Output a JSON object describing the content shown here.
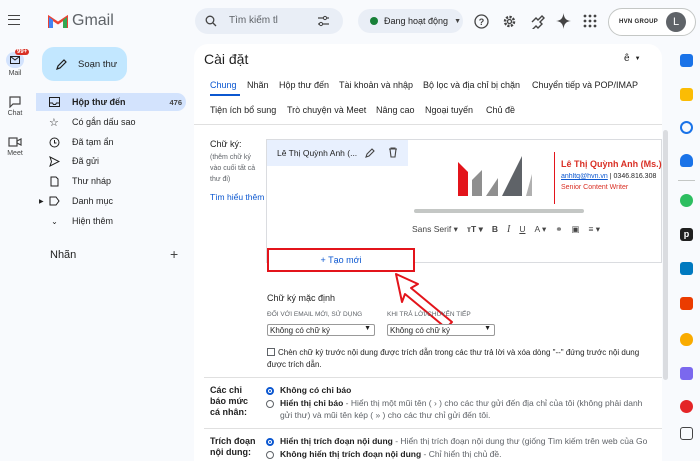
{
  "rail": {
    "mail_label": "Mail",
    "mail_badge": "99+",
    "chat_label": "Chat",
    "meet_label": "Meet"
  },
  "header": {
    "app_title": "Gmail",
    "search_placeholder": "Tìm kiếm tl",
    "status": "Đang hoạt động",
    "org": "HVN GROUP",
    "avatar_letter": "L"
  },
  "compose": {
    "label": "Soạn thư"
  },
  "nav": [
    {
      "label": "Hộp thư đến",
      "count": "476",
      "active": true
    },
    {
      "label": "Có gắn dấu sao",
      "count": ""
    },
    {
      "label": "Đã tạm ẩn",
      "count": ""
    },
    {
      "label": "Đã gửi",
      "count": ""
    },
    {
      "label": "Thư nháp",
      "count": ""
    },
    {
      "label": "Danh mục",
      "count": ""
    },
    {
      "label": "Hiện thêm",
      "count": ""
    }
  ],
  "labels_section": {
    "title": "Nhãn"
  },
  "settings": {
    "title": "Cài đặt",
    "lang_icon": "ê",
    "tabs_row1": [
      "Chung",
      "Nhãn",
      "Hộp thư đến",
      "Tài khoản và nhập",
      "Bộ lọc và địa chỉ bị chặn",
      "Chuyển tiếp và POP/IMAP"
    ],
    "tabs_row2": [
      "Tiện ích bổ sung",
      "Trò chuyện và Meet",
      "Nâng cao",
      "Ngoại tuyến",
      "Chủ đề"
    ]
  },
  "signature": {
    "label": "Chữ ký:",
    "help": "(thêm chữ ký vào cuối tất cả thư đi)",
    "learn_more": "Tìm hiểu thêm",
    "entry_name": "Lê Thị Quỳnh Anh (...",
    "preview_name": "Lê Thị Quỳnh Anh (Ms.)",
    "preview_email": "anhltq@hvn.vn",
    "preview_phone": "| 0346.816.308",
    "preview_role": "Senior Content Writer",
    "font": "Sans Serif",
    "create_new": "+ Tạo mới",
    "default_title": "Chữ ký mặc định",
    "new_email_label": "ĐỐI VỚI EMAIL MỚI, SỬ DỤNG",
    "reply_label": "KHI TRẢ LỜI/CHUYỂN TIẾP",
    "new_email_value": "Không có chữ ký",
    "reply_value": "Không có chữ ký",
    "insert_before_text": "Chèn chữ ký trước nội dung được trích dẫn trong các thư trả lời và xóa dòng \"--\" đứng trước nội dung",
    "insert_before_text2": "được trích dẫn."
  },
  "indicators": {
    "label": "Các chỉ báo mức cá nhân:",
    "opt1": "Không có chỉ báo",
    "opt2_bold": "Hiển thị chỉ báo",
    "opt2_desc": " - Hiển thị một mũi tên ( › ) cho các thư gửi đến địa chỉ của tôi (không phải danh",
    "opt2_desc2": "gửi thư) và mũi tên kép ( » ) cho các thư chỉ gửi đến tôi."
  },
  "snippets": {
    "label": "Trích đoạn nội dung:",
    "opt1_bold": "Hiển thị trích đoạn nội dung",
    "opt1_desc": " - Hiển thị trích đoạn nội dung thư (giống Tìm kiếm trên web của Go",
    "opt2_bold": "Không hiển thị trích đoạn nội dung",
    "opt2_desc": " - Chỉ hiển thị chủ đề."
  },
  "colors": {
    "accent": "#0b57d0",
    "brand_red": "#d93025",
    "highlight": "#e3141b"
  }
}
